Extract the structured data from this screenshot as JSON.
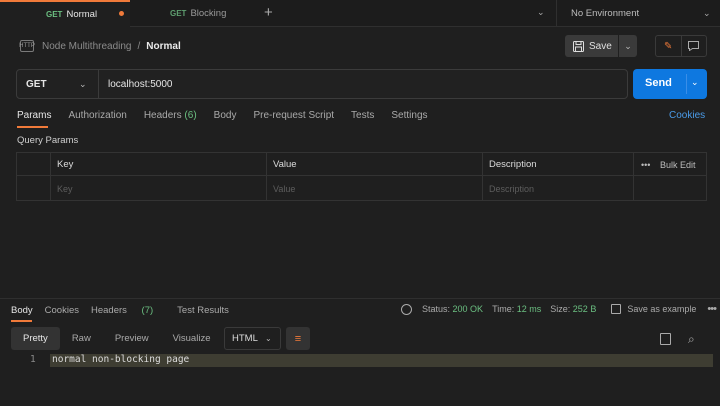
{
  "tabs": [
    {
      "method": "GET",
      "label": "Normal",
      "active": true,
      "unsaved": true
    },
    {
      "method": "GET",
      "label": "Blocking",
      "active": false
    }
  ],
  "environment": "No Environment",
  "breadcrumb": {
    "icon_text": "HTTP",
    "collection": "Node Multithreading",
    "separator": "/",
    "request": "Normal"
  },
  "toolbar": {
    "save_label": "Save"
  },
  "request": {
    "method": "GET",
    "url": "localhost:5000",
    "send_label": "Send"
  },
  "request_tabs": {
    "params": "Params",
    "authorization": "Authorization",
    "headers": "Headers",
    "headers_count": "(6)",
    "body": "Body",
    "prerequest": "Pre-request Script",
    "tests": "Tests",
    "settings": "Settings",
    "cookies": "Cookies"
  },
  "query_params": {
    "title": "Query Params",
    "columns": {
      "key": "Key",
      "value": "Value",
      "description": "Description"
    },
    "bulk_edit": "Bulk Edit",
    "placeholders": {
      "key": "Key",
      "value": "Value",
      "description": "Description"
    }
  },
  "response_tabs": {
    "body": "Body",
    "cookies": "Cookies",
    "headers": "Headers",
    "headers_count": "(7)",
    "test_results": "Test Results"
  },
  "response_status": {
    "status_label": "Status:",
    "status_value": "200 OK",
    "time_label": "Time:",
    "time_value": "12 ms",
    "size_label": "Size:",
    "size_value": "252 B",
    "save_example": "Save as example"
  },
  "view_modes": {
    "pretty": "Pretty",
    "raw": "Raw",
    "preview": "Preview",
    "visualize": "Visualize",
    "format": "HTML"
  },
  "response_body": {
    "line_number": "1",
    "content": "normal non-blocking page"
  },
  "colors": {
    "accent": "#f07a3a",
    "send": "#0e78e0",
    "method_get": "#6bbf81",
    "link": "#4a9be8"
  }
}
